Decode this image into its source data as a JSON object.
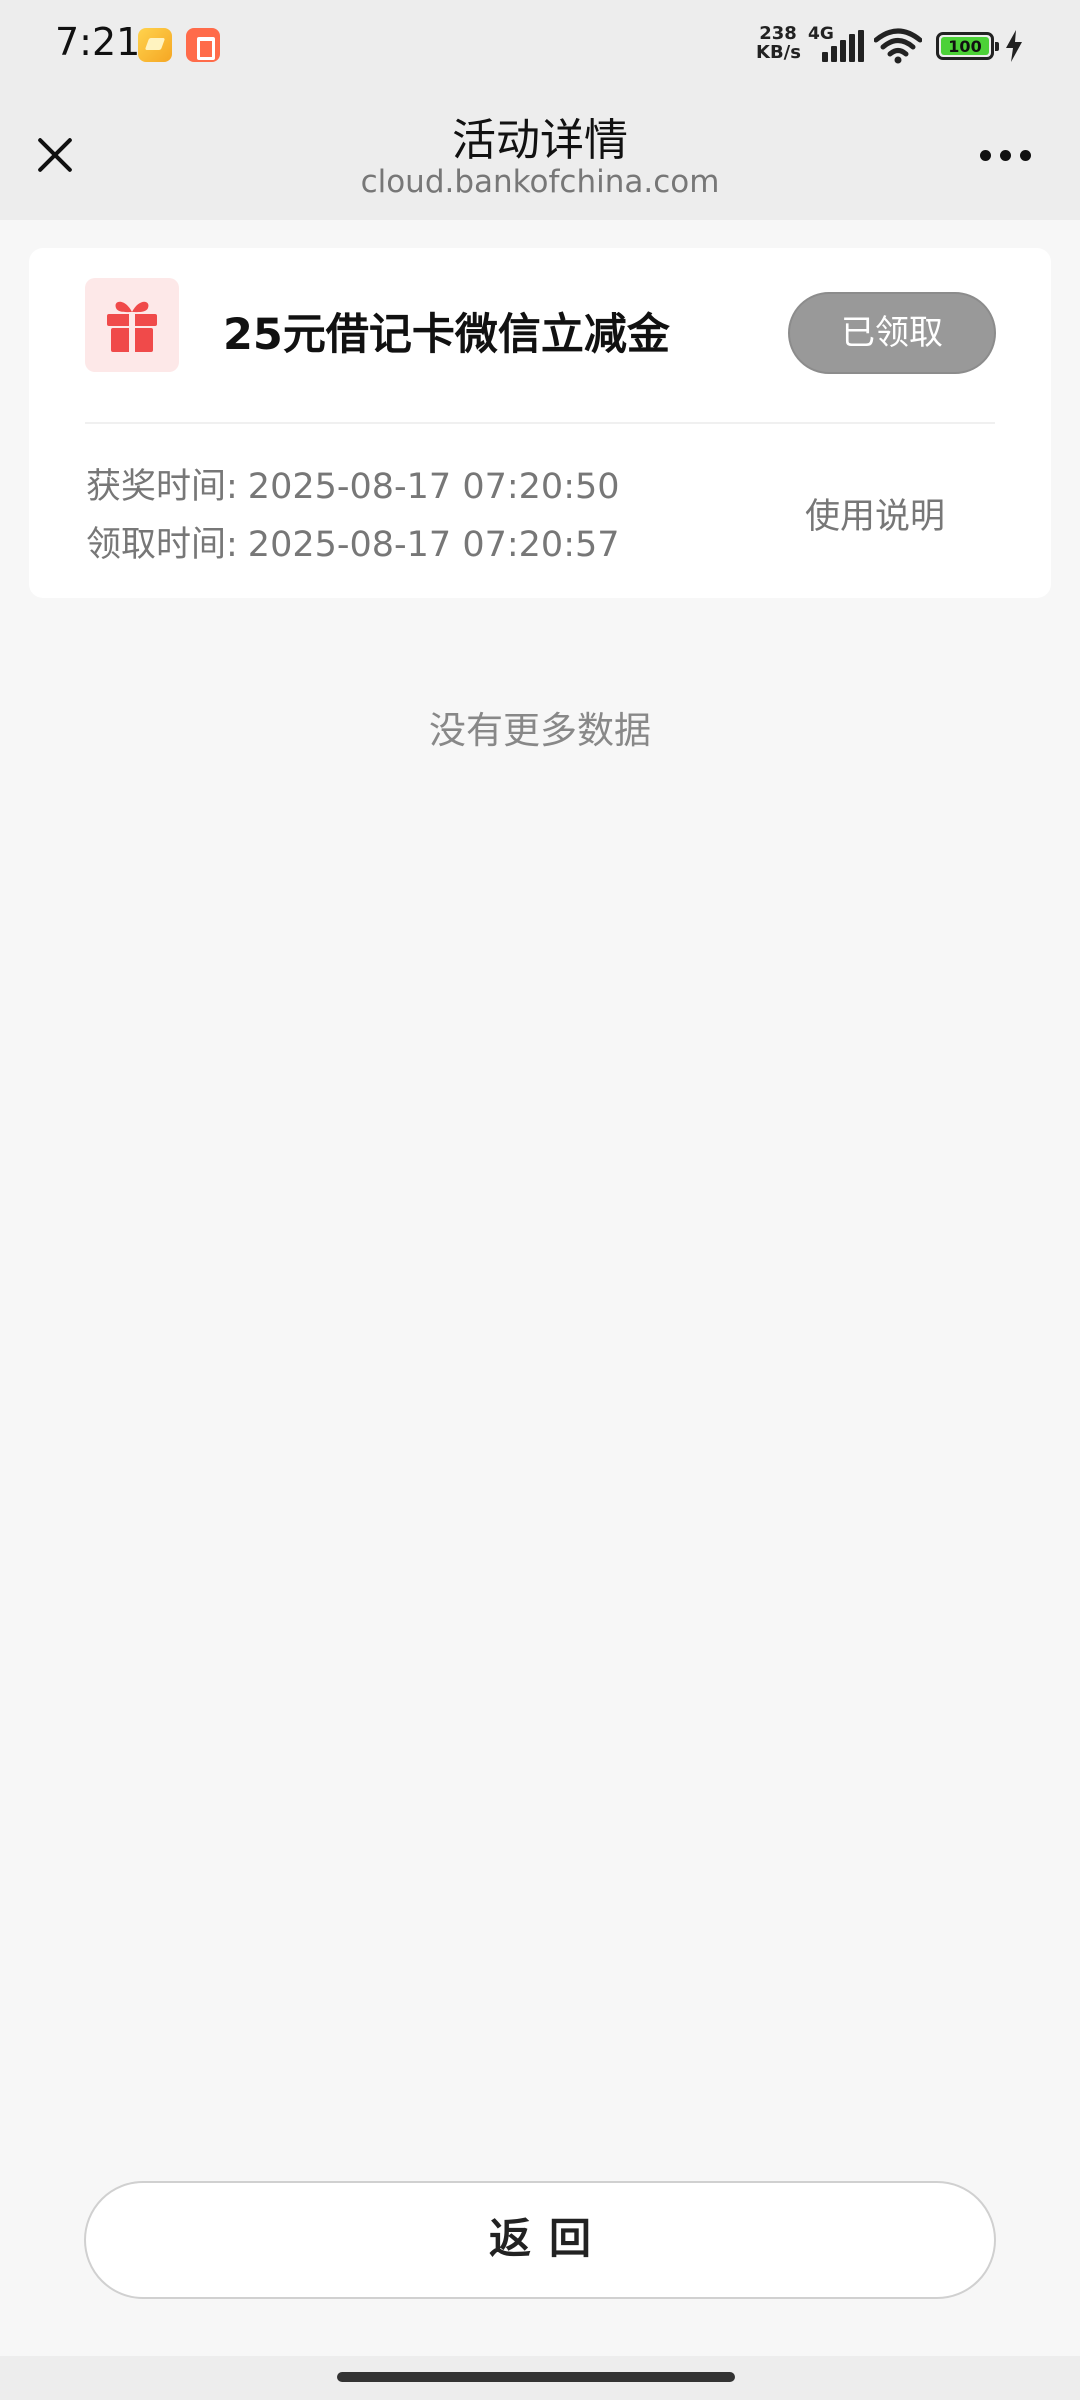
{
  "status_bar": {
    "time": "7:21",
    "net_speed_value": "238",
    "net_speed_unit": "KB/s",
    "network_type": "4G",
    "battery_level": "100",
    "battery_color": "#4cd137"
  },
  "header": {
    "title": "活动详情",
    "subtitle": "cloud.bankofchina.com",
    "close_icon": "close-icon",
    "more_icon": "more-icon"
  },
  "reward_card": {
    "icon": "gift-icon",
    "icon_color": "#f04a4a",
    "title": "25元借记卡微信立减金",
    "status_button": "已领取",
    "award_time_label": "获奖时间:",
    "award_time_value": "2025-08-17 07:20:50",
    "claim_time_label": "领取时间:",
    "claim_time_value": "2025-08-17 07:20:57",
    "usage_link": "使用说明"
  },
  "list_footer": "没有更多数据",
  "back_button": "返回"
}
